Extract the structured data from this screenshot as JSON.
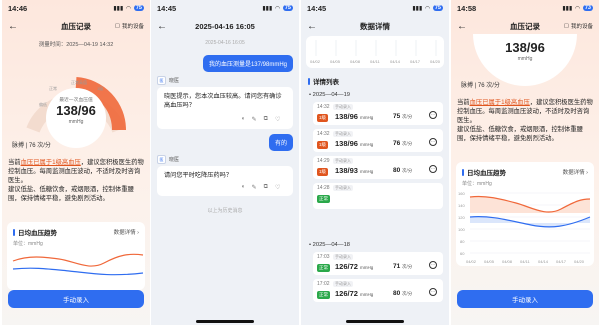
{
  "colors": {
    "accent": "#2f6df0",
    "warning": "#e0551e",
    "normal": "#2aa84a",
    "high_line": "#f0683a"
  },
  "p1": {
    "status_time": "14:46",
    "nav_title": "血压记录",
    "nav_right": "我的设备",
    "measure_time": "测量时间：2025—04-19 14:32",
    "gauge_caption": "最近一次血压值",
    "bp_value": "138/96",
    "bp_unit": "mmHg",
    "gauge_labels": [
      "偏低",
      "正常",
      "正常高值",
      "1级",
      "2级",
      "3级"
    ],
    "pulse": "脉搏 | 76 次/分",
    "advice_prefix": "当前",
    "advice_highlight": "血压已属于1级高血压",
    "advice_rest": "，建议您积极医生药物控制血压。每周监测血压波动，不适时及时咨询医生。",
    "advice_tips": "建议低盐、低糖饮食，戒烟限酒，控制体重腰围，保持情绪平稳，避免剧烈活动。",
    "trend_title": "日均血压趋势",
    "trend_more": "数据详情",
    "trend_unit": "单位：mmHg",
    "button": "手动录入"
  },
  "p2": {
    "status_time": "14:45",
    "date_header": "2025-04-16 16:05",
    "date_small": "2025-04-16 16:05",
    "user_msg": "我的血压测量是137/98mmHg",
    "bot_name": "晓医",
    "bot_msg": "晓医提示，您本次血压较高。请问您有确诊高血压吗？",
    "user_reply": "有的",
    "bot_name2": "晓医",
    "bot_msg2": "请问您平时吃降压药吗？",
    "footer": "以上为历史消息"
  },
  "p3": {
    "status_time": "14:45",
    "nav_title": "数据详情",
    "list_title": "详情列表",
    "x_ticks": [
      "04/02",
      "04/05",
      "04/08",
      "04/11",
      "04/14",
      "04/17",
      "04/20"
    ],
    "groups": [
      {
        "date": "2025—04—19",
        "records": [
          {
            "time": "14:32",
            "source": "手动录入",
            "level": "1级",
            "level_color": "#e0551e",
            "bp": "138/96",
            "unit": "mmHg",
            "hr": "75",
            "hr_unit": "次/分"
          },
          {
            "time": "14:32",
            "source": "手动录入",
            "level": "1级",
            "level_color": "#e0551e",
            "bp": "138/96",
            "unit": "mmHg",
            "hr": "76",
            "hr_unit": "次/分"
          },
          {
            "time": "14:29",
            "source": "手动录入",
            "level": "1级",
            "level_color": "#e0551e",
            "bp": "138/93",
            "unit": "mmHg",
            "hr": "80",
            "hr_unit": "次/分"
          },
          {
            "time": "14:28",
            "source": "手动录入",
            "level": "正常",
            "level_color": "#2aa84a",
            "bp": "",
            "unit": "",
            "hr": "",
            "hr_unit": ""
          }
        ]
      },
      {
        "date": "2025—04—18",
        "records": [
          {
            "time": "17:03",
            "source": "手动录入",
            "level": "正常",
            "level_color": "#2aa84a",
            "bp": "126/72",
            "unit": "mmHg",
            "hr": "71",
            "hr_unit": "次/分"
          },
          {
            "time": "17:02",
            "source": "手动录入",
            "level": "正常",
            "level_color": "#2aa84a",
            "bp": "126/72",
            "unit": "mmHg",
            "hr": "80",
            "hr_unit": "次/分"
          }
        ]
      }
    ]
  },
  "p4": {
    "status_time": "14:58",
    "nav_title": "血压记录",
    "nav_right": "我的设备",
    "bp_value": "138/96",
    "bp_unit": "mmHg",
    "pulse": "脉搏 | 76 次/分",
    "advice_prefix": "当前",
    "advice_highlight": "血压已属于1级高血压",
    "advice_rest": "，建议您积极医生药物控制血压。每周监测血压波动，不适时及时咨询医生。",
    "advice_tips": "建议低盐、低糖饮食，戒烟限酒，控制体重腰围，保持情绪平稳，避免剧烈活动。",
    "trend_title": "日均血压趋势",
    "trend_more": "数据详情",
    "trend_unit": "单位：mmHg",
    "y_ticks": [
      "160",
      "140",
      "120",
      "100",
      "80",
      "60"
    ],
    "x_ticks": [
      "04/02",
      "04/05",
      "04/08",
      "04/11",
      "04/14",
      "04/17",
      "04/20"
    ],
    "button": "手动录入"
  }
}
